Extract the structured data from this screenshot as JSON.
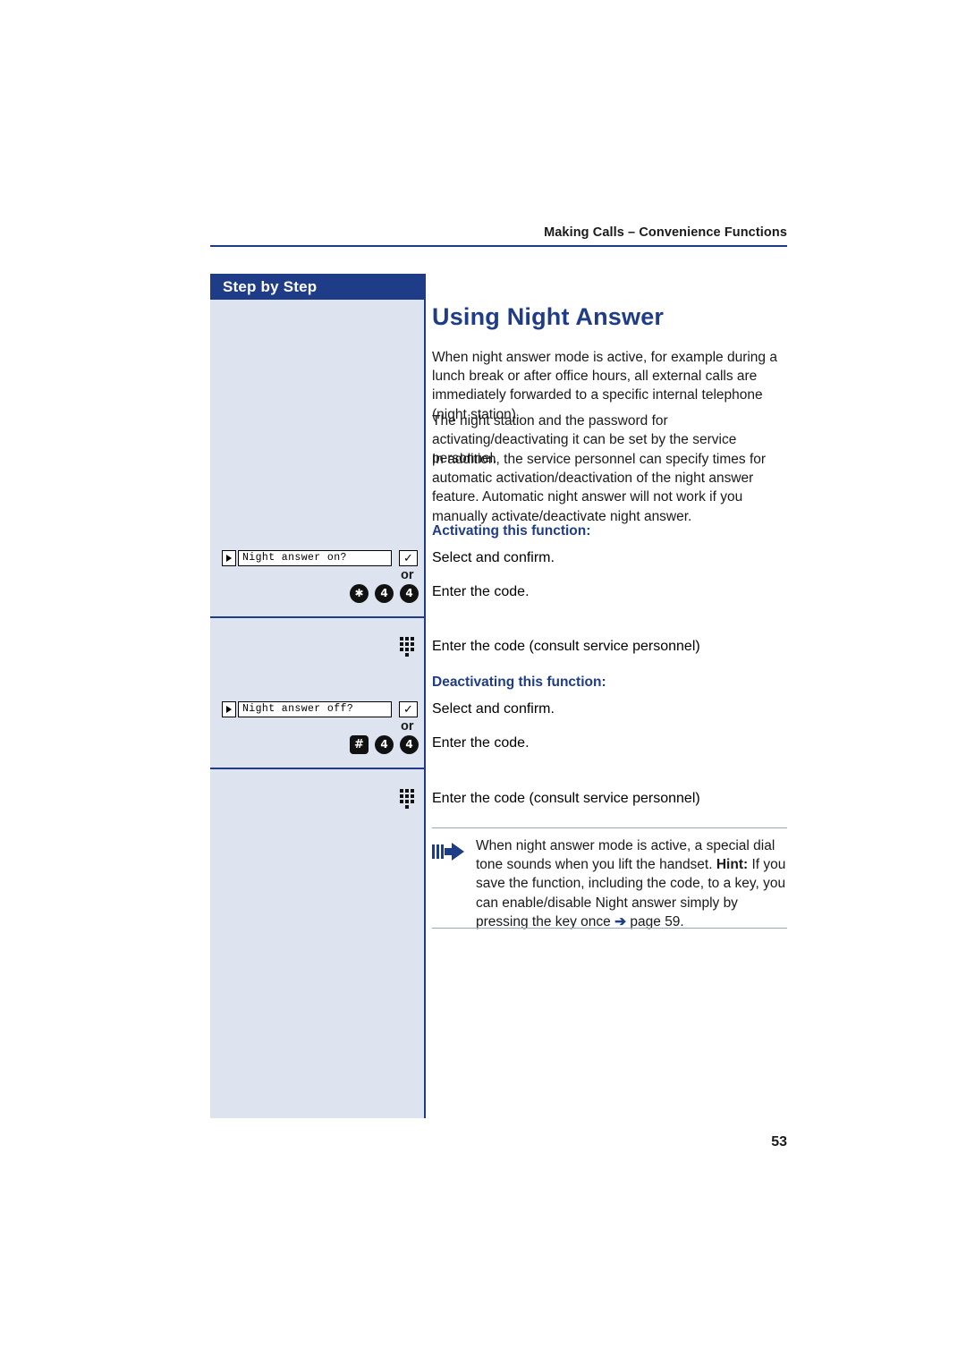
{
  "header": {
    "breadcrumb": "Making Calls – Convenience Functions"
  },
  "sidebar": {
    "title": "Step by Step"
  },
  "main": {
    "title": "Using Night Answer",
    "intro_p1": "When night answer mode is active, for example during a lunch break or after office hours, all external calls are immediately forwarded to a specific internal telephone (night station).",
    "intro_p2": " The night station and the password for activating/deactivating it can be set by the service personnel.",
    "intro_p3": "In addition, the service personnel can specify times for automatic activation/deactivation of the night answer feature. Automatic night answer will not work if you manually activate/deactivate night answer.",
    "activating_heading": "Activating this function:",
    "deactivating_heading": "Deactivating this function:",
    "select_confirm_1": "Select and confirm.",
    "enter_code_1": "Enter the code.",
    "enter_code_consult_1": "Enter the code (consult service personnel)",
    "select_confirm_2": "Select and confirm.",
    "enter_code_2": "Enter the code.",
    "enter_code_consult_2": "Enter the code (consult service personnel)"
  },
  "steps": {
    "display_on": {
      "arrow_icon": "right-arrow-icon",
      "text": "Night answer on?",
      "check_icon": "✓"
    },
    "display_off": {
      "arrow_icon": "right-arrow-icon",
      "text": "Night answer off?",
      "check_icon": "✓"
    },
    "or_1": "or",
    "or_2": "or",
    "code_on_keys": [
      "✱",
      "4",
      "4"
    ],
    "code_off_keys": [
      "#",
      "4",
      "4"
    ],
    "keypad_icon_1": "keypad-icon",
    "keypad_icon_2": "keypad-icon"
  },
  "hint": {
    "line1": "When night answer mode is active, a special dial tone sounds when you lift the handset.",
    "label": "Hint:",
    "line2": " If you save the function, including the code, to a key, you can enable/disable Night answer simply by pressing the key once ",
    "arrow": "➔",
    "page_ref": " page 59."
  },
  "footer": {
    "page_number": "53"
  },
  "colors": {
    "accent": "#1f3c88",
    "sidebar_bg": "#dde4f0"
  }
}
